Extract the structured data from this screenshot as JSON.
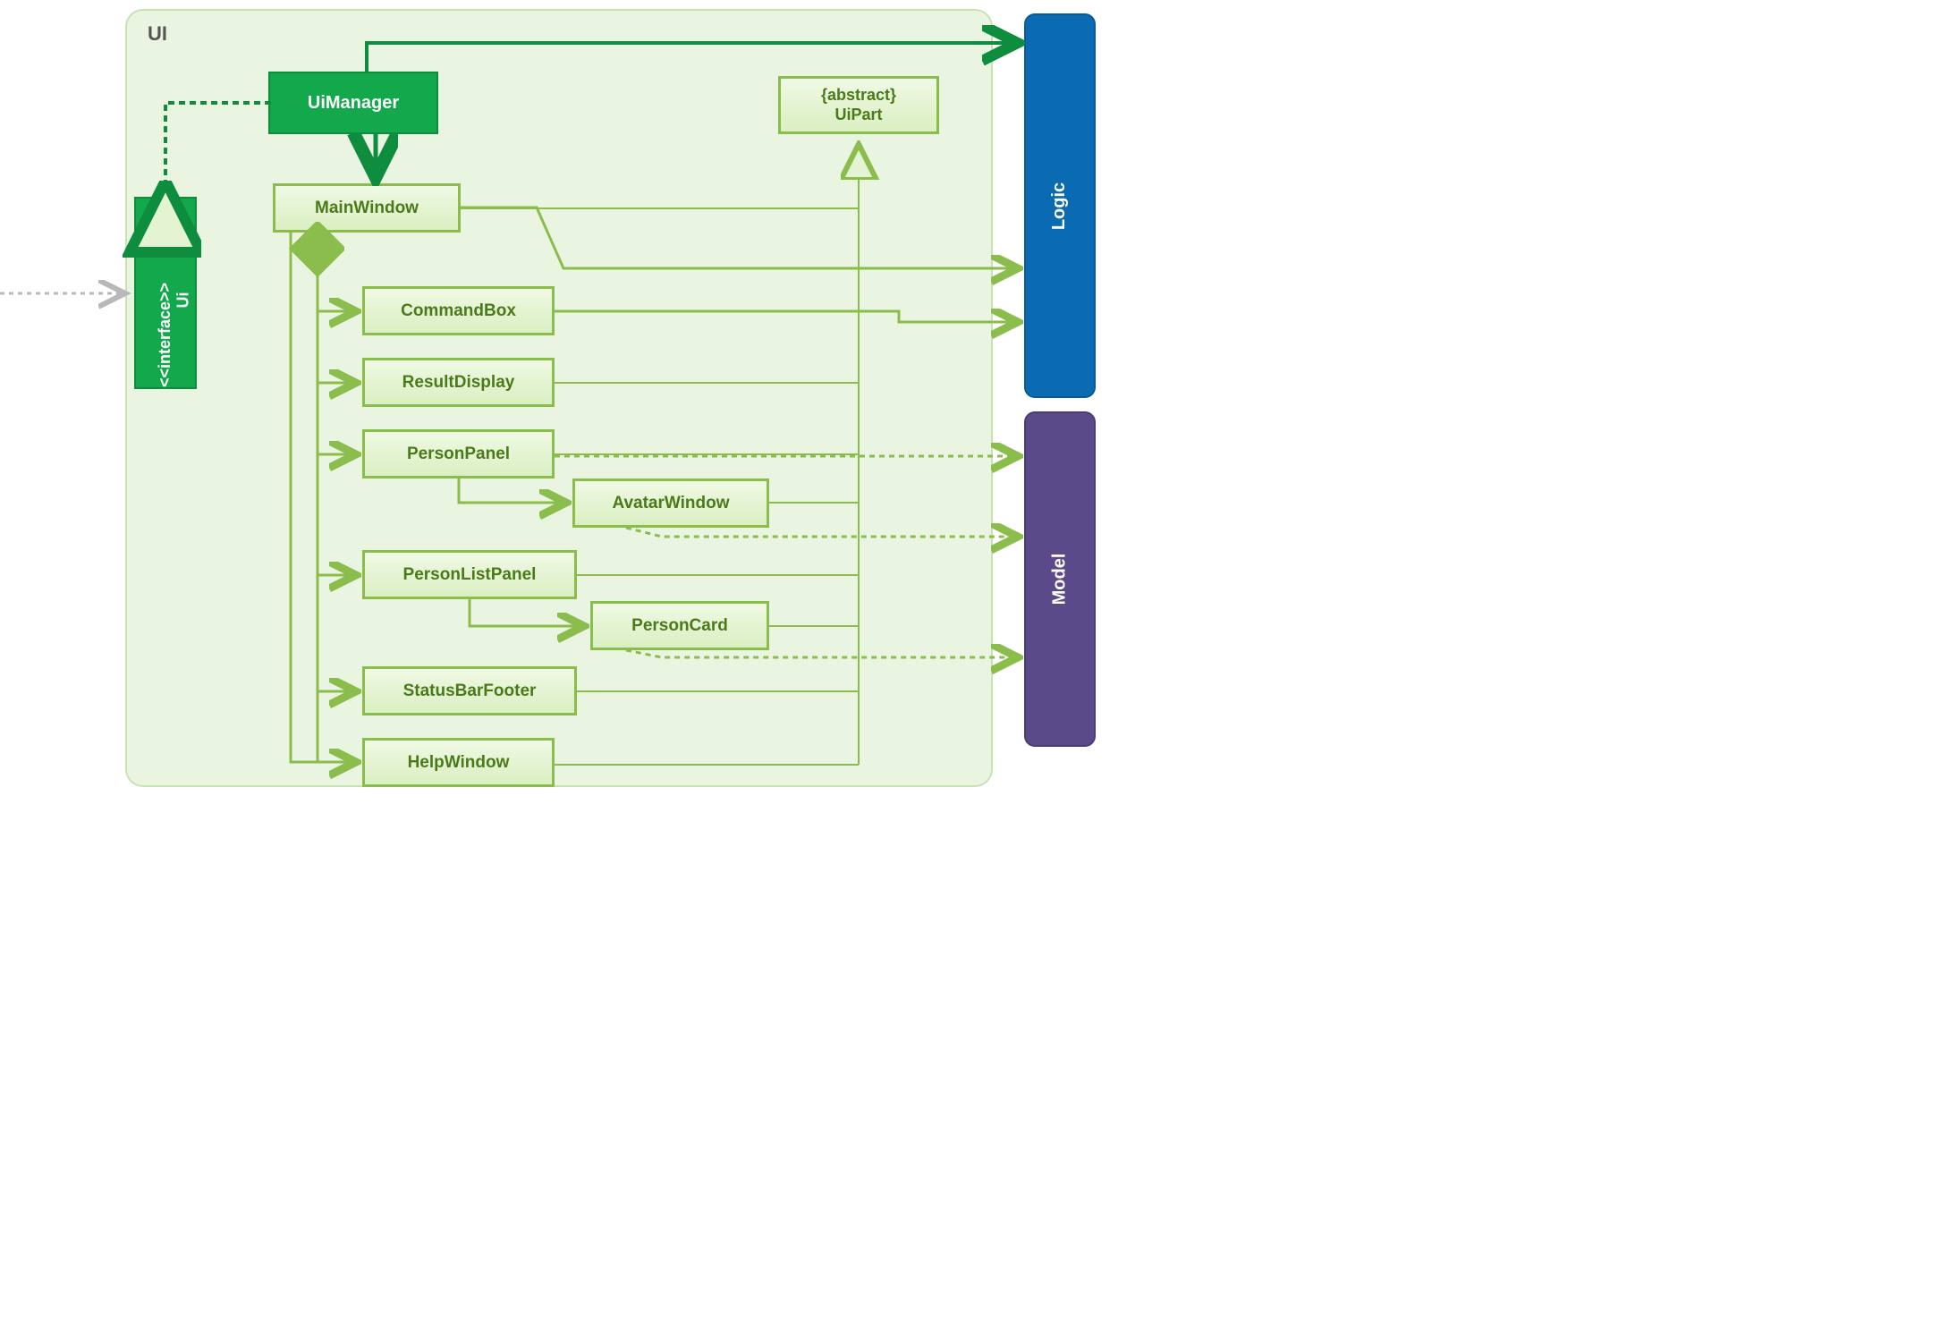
{
  "package": {
    "title": "UI"
  },
  "classes": {
    "uimanager": "UiManager",
    "interface_stereo": "<<interface>>",
    "interface_name": "Ui",
    "mainwindow": "MainWindow",
    "commandbox": "CommandBox",
    "resultdisplay": "ResultDisplay",
    "personpanel": "PersonPanel",
    "avatarwindow": "AvatarWindow",
    "personlistpanel": "PersonListPanel",
    "personcard": "PersonCard",
    "statusbarfooter": "StatusBarFooter",
    "helpwindow": "HelpWindow",
    "uipart_stereo": "{abstract}",
    "uipart_name": "UiPart",
    "logic": "Logic",
    "model": "Model"
  },
  "colors": {
    "ui_bg": "#e9f5e0",
    "ui_border": "#c9e2b4",
    "uimanager_bg": "#14a84d",
    "uimanager_border": "#0e8d3f",
    "interface_bg": "#14a84d",
    "light_bg": "#e4f4d3",
    "light_border": "#8bbd4d",
    "light_text": "#4a7a1a",
    "logic_bg": "#0a6ab2",
    "logic_border": "#0a5a96",
    "model_bg": "#5b4a8a",
    "model_border": "#4a3d72",
    "dark_green": "#0e8d3f",
    "olive": "#8bbd4d",
    "gray": "#b8b8b8"
  }
}
